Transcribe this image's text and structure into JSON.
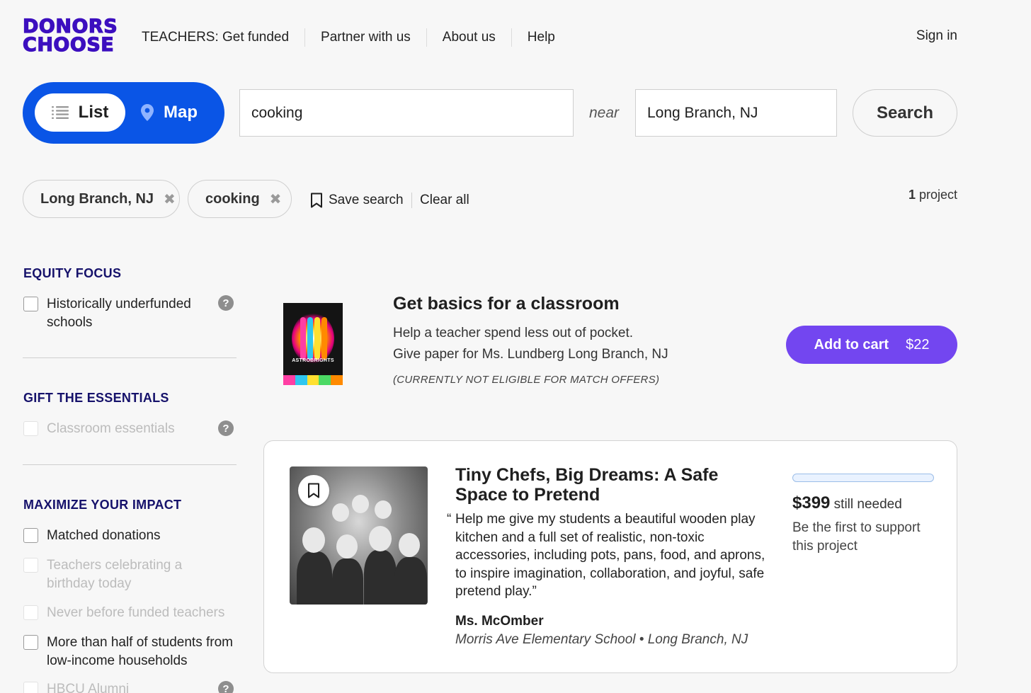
{
  "header": {
    "logo_line1": "DONORS",
    "logo_line2": "CHOOSE",
    "nav": [
      "TEACHERS: Get funded",
      "Partner with us",
      "About us",
      "Help"
    ],
    "sign_in": "Sign in"
  },
  "view_toggle": {
    "list": "List",
    "map": "Map",
    "selected": "List"
  },
  "search": {
    "keyword_value": "cooking",
    "near_label": "near",
    "location_value": "Long Branch, NJ",
    "button": "Search"
  },
  "filters": {
    "chips": [
      "Long Branch, NJ",
      "cooking"
    ],
    "remove_glyph": "✖",
    "save_search": "Save search",
    "clear_all": "Clear all",
    "result_count": "1",
    "result_label": "project"
  },
  "sidebar": {
    "sections": [
      {
        "title": "EQUITY FOCUS",
        "items": [
          {
            "label": "Historically underfunded schools",
            "enabled": true,
            "help": true
          }
        ]
      },
      {
        "title": "GIFT THE ESSENTIALS",
        "items": [
          {
            "label": "Classroom essentials",
            "enabled": false,
            "help": true
          }
        ]
      },
      {
        "title": "MAXIMIZE YOUR IMPACT",
        "items": [
          {
            "label": "Matched donations",
            "enabled": true
          },
          {
            "label": "Teachers celebrating a birthday today",
            "enabled": false
          },
          {
            "label": "Never before funded teachers",
            "enabled": false
          },
          {
            "label": "More than half of students from low-income households",
            "enabled": true
          },
          {
            "label": "HBCU Alumni",
            "enabled": false,
            "help": true
          }
        ]
      }
    ],
    "help_glyph": "?"
  },
  "promo": {
    "product_brand": "ASTROBRIGHTS",
    "title": "Get basics for a classroom",
    "line1": "Help a teacher spend less out of pocket.",
    "line2": "Give paper for Ms. Lundberg Long Branch, NJ",
    "note": "(CURRENTLY NOT ELIGIBLE FOR MATCH OFFERS)",
    "button_label": "Add to cart",
    "button_price": "$22"
  },
  "project": {
    "title": "Tiny Chefs, Big Dreams: A Safe Space to Pretend",
    "quote_open": "“",
    "quote": "Help me give my students a beautiful wooden play kitchen and a full set of realistic, non-toxic accessories, including pots, pans, food, and aprons, to inspire imagination, collaboration, and joyful, safe pretend play.”",
    "teacher": "Ms. McOmber",
    "school": "Morris Ave Elementary School • Long Branch, NJ",
    "amount_needed": "$399",
    "needed_label": "still needed",
    "support_text": "Be the first to support this project"
  },
  "chart_data": {
    "type": "progress",
    "funded_fraction": 0,
    "amount_still_needed": 399
  },
  "colors": {
    "brand_purple": "#3c0fbf",
    "toggle_blue": "#0a55e6",
    "cart_purple": "#7346f0",
    "section_title": "#16126b",
    "bar_border": "#9bbde8",
    "bar_fill": "#0a55e6"
  },
  "icons": {
    "list": "list-icon",
    "map": "map-pin-icon",
    "remove": "close-icon",
    "save": "bookmark-icon",
    "help": "help-circle-icon",
    "project_save": "bookmark-icon"
  }
}
